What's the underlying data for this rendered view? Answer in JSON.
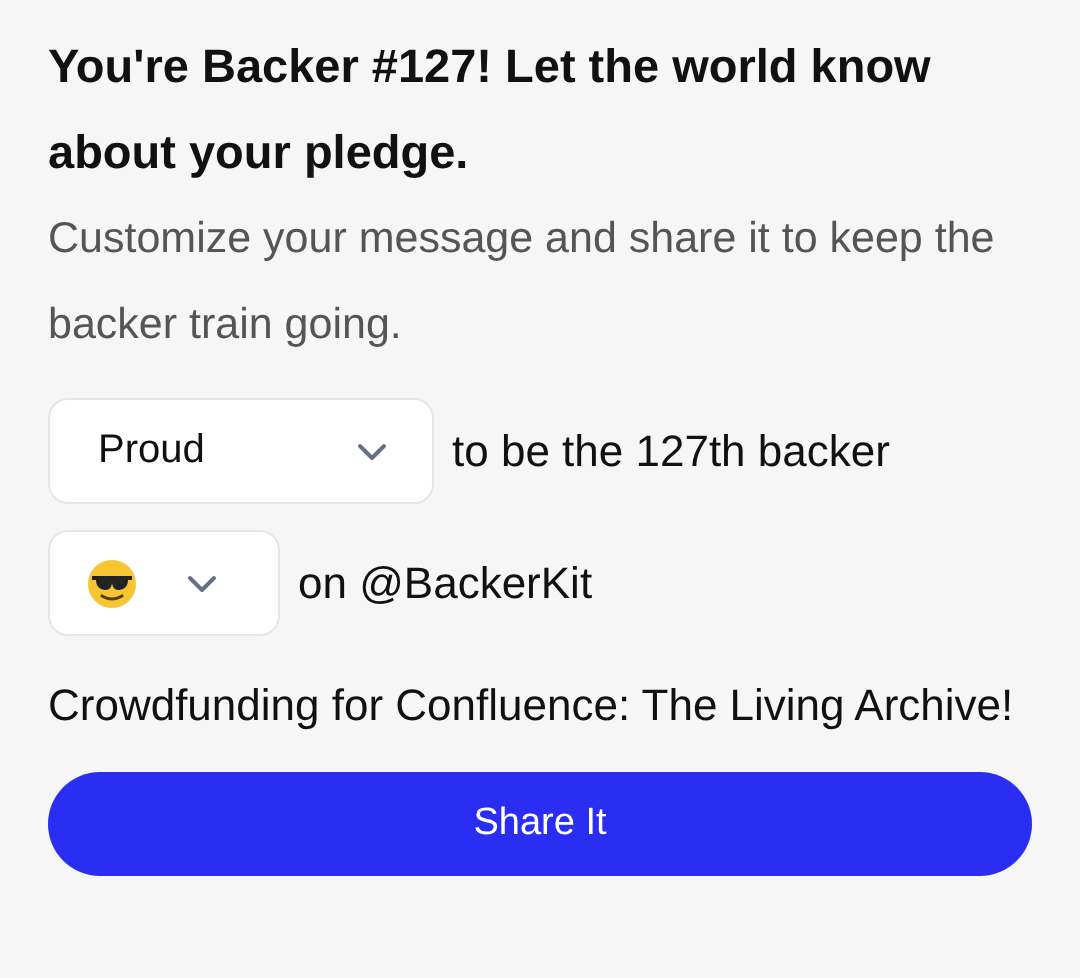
{
  "heading": "You're Backer #127! Let the world know about your pledge.",
  "description": "Customize your message and share it to keep the backer train going.",
  "message": {
    "adjective_select": {
      "value": "Proud"
    },
    "adjective_suffix": "to be the 127th backer",
    "emoji_select": {
      "kind": "emoji"
    },
    "emoji_suffix": "on @BackerKit"
  },
  "campaign_text": "Crowdfunding for Confluence: The Living Archive!",
  "share_button": "Share It"
}
